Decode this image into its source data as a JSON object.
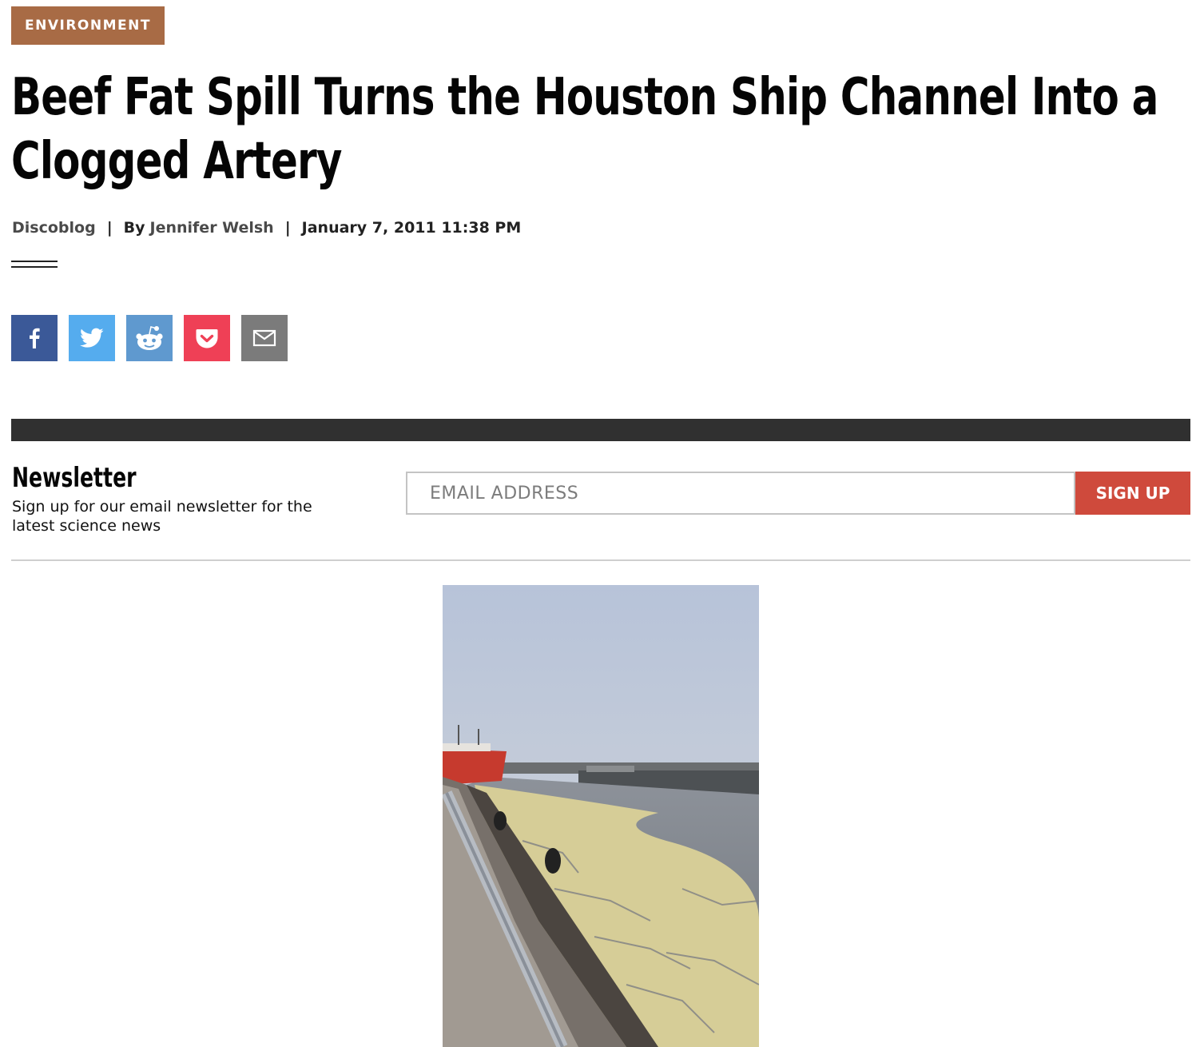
{
  "category": "ENVIRONMENT",
  "article": {
    "headline": "Beef Fat Spill Turns the Houston Ship Channel Into a Clogged Artery",
    "blog": "Discoblog",
    "by_prefix": "By",
    "author": "Jennifer Welsh",
    "separator": "|",
    "date": "January 7, 2011 11:38 PM"
  },
  "share": {
    "buttons": [
      {
        "icon": "facebook-icon",
        "color": "#3b5998"
      },
      {
        "icon": "twitter-icon",
        "color": "#55acee"
      },
      {
        "icon": "reddit-icon",
        "color": "#5f99cf"
      },
      {
        "icon": "pocket-icon",
        "color": "#ef4056"
      },
      {
        "icon": "email-icon",
        "color": "#7b7b7b"
      }
    ]
  },
  "newsletter": {
    "title": "Newsletter",
    "description": "Sign up for our email newsletter for the latest science news",
    "email_placeholder": "EMAIL ADDRESS",
    "signup_label": "SIGN UP"
  },
  "colors": {
    "category_bg": "#a86b45",
    "signup_bg": "#cf4a3c",
    "dark_bar": "#303030"
  }
}
